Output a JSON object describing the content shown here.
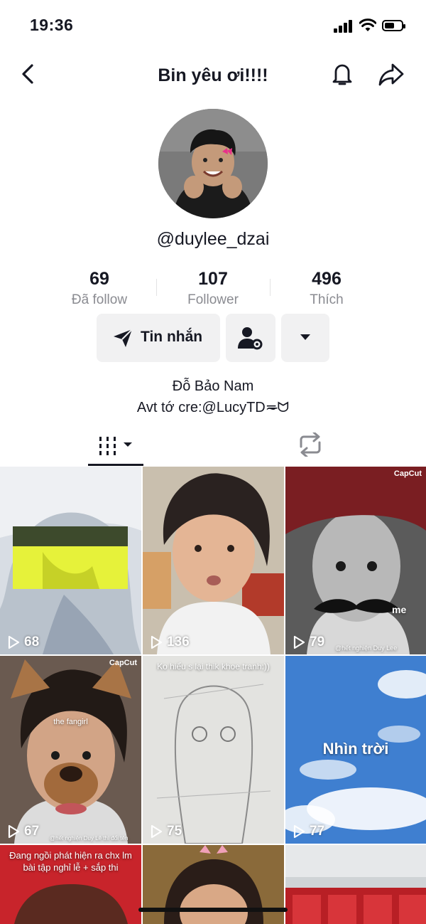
{
  "status": {
    "time": "19:36"
  },
  "header": {
    "title": "Bin yêu ơi!!!!"
  },
  "profile": {
    "handle": "@duylee_dzai"
  },
  "stats": [
    {
      "num": "69",
      "label": "Đã follow"
    },
    {
      "num": "107",
      "label": "Follower"
    },
    {
      "num": "496",
      "label": "Thích"
    }
  ],
  "actions": {
    "message_label": "Tin nhắn"
  },
  "bio": {
    "line1": "Đỗ Bảo Nam",
    "line2": "Avt tớ cre:@LucyTD≂̶ᗢ"
  },
  "videos": [
    {
      "views": "68"
    },
    {
      "views": "136"
    },
    {
      "views": "79",
      "overlay": "me",
      "badge": "CapCut",
      "watermark": "@hết nghiện Duy Lee"
    },
    {
      "views": "67",
      "overlay": "the fangirl",
      "badge": "CapCut",
      "watermark": "@hết nghiện Duy Lê thì đổi tên"
    },
    {
      "views": "75",
      "overlay": "Ko hiểu s lại thik khoe tranh:))"
    },
    {
      "views": "77",
      "overlay": "Nhìn trời"
    },
    {
      "overlay": "Đang ngồi phát hiện ra chx lm bài tập nghỉ lễ + sắp thi"
    },
    {},
    {}
  ],
  "colors": {
    "text": "#161823",
    "muted": "#8a8b91",
    "button_bg": "#f1f1f2"
  }
}
